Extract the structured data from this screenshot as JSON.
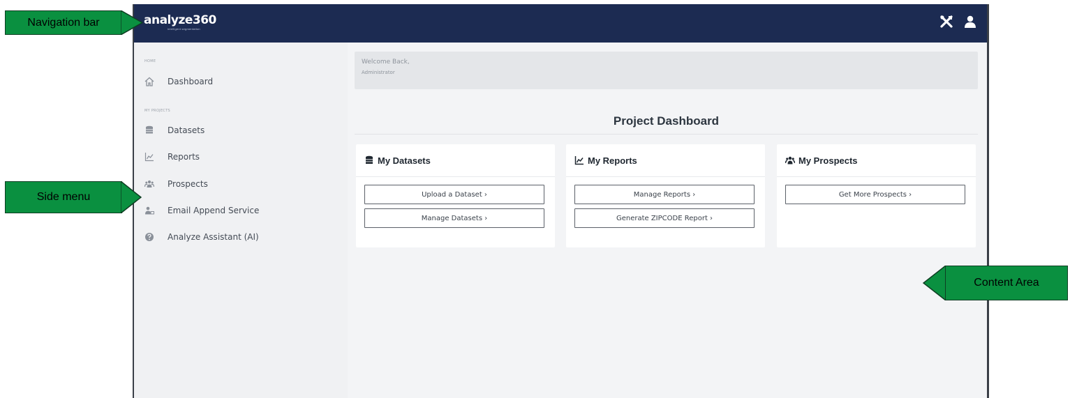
{
  "app": {
    "logo_text": "analyze360",
    "logo_tagline": "intelligent segmentation",
    "top_icons": [
      "tools-icon",
      "user-icon"
    ]
  },
  "sidebar": {
    "sections": [
      {
        "label": "HOME",
        "items": [
          {
            "label": "Dashboard",
            "icon": "home-icon"
          }
        ]
      },
      {
        "label": "MY PROJECTS",
        "items": [
          {
            "label": "Datasets",
            "icon": "database-icon"
          },
          {
            "label": "Reports",
            "icon": "chart-icon"
          },
          {
            "label": "Prospects",
            "icon": "users-icon"
          },
          {
            "label": "Email Append Service",
            "icon": "email-append-icon"
          },
          {
            "label": "Analyze Assistant (AI)",
            "icon": "help-icon"
          }
        ]
      }
    ]
  },
  "welcome": {
    "line1": "Welcome Back,",
    "line2": "Administrator"
  },
  "dashboard": {
    "title": "Project Dashboard",
    "cards": [
      {
        "title": "My Datasets",
        "icon": "database-icon",
        "buttons": [
          "Upload a Dataset ›",
          "Manage Datasets ›"
        ]
      },
      {
        "title": "My Reports",
        "icon": "chart-icon",
        "buttons": [
          "Manage Reports ›",
          "Generate ZIPCODE Report ›"
        ]
      },
      {
        "title": "My Prospects",
        "icon": "users-icon",
        "buttons": [
          "Get More Prospects ›"
        ]
      }
    ]
  },
  "callouts": {
    "navigation_bar": "Navigation bar",
    "side_menu": "Side menu",
    "content_area": "Content Area"
  },
  "colors": {
    "topbar": "#1c2b52",
    "callout": "#0a9040"
  }
}
